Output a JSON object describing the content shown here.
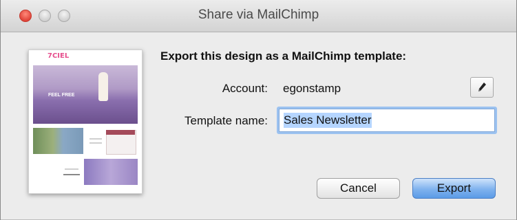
{
  "window": {
    "title": "Share via MailChimp"
  },
  "preview": {
    "logo_text": "7CIEL",
    "hero_text": "FEEL FREE"
  },
  "form": {
    "heading": "Export this design as a MailChimp template:",
    "account_label": "Account:",
    "account_value": "egonstamp",
    "template_label": "Template name:",
    "template_value": "Sales Newsletter"
  },
  "buttons": {
    "cancel": "Cancel",
    "export": "Export"
  },
  "icons": {
    "edit": "pencil-icon"
  },
  "colors": {
    "close": "#e0443a",
    "focus_ring": "#9cc2f0",
    "default_button": "#7fb2ee",
    "text_selection": "#b5d5ff"
  }
}
